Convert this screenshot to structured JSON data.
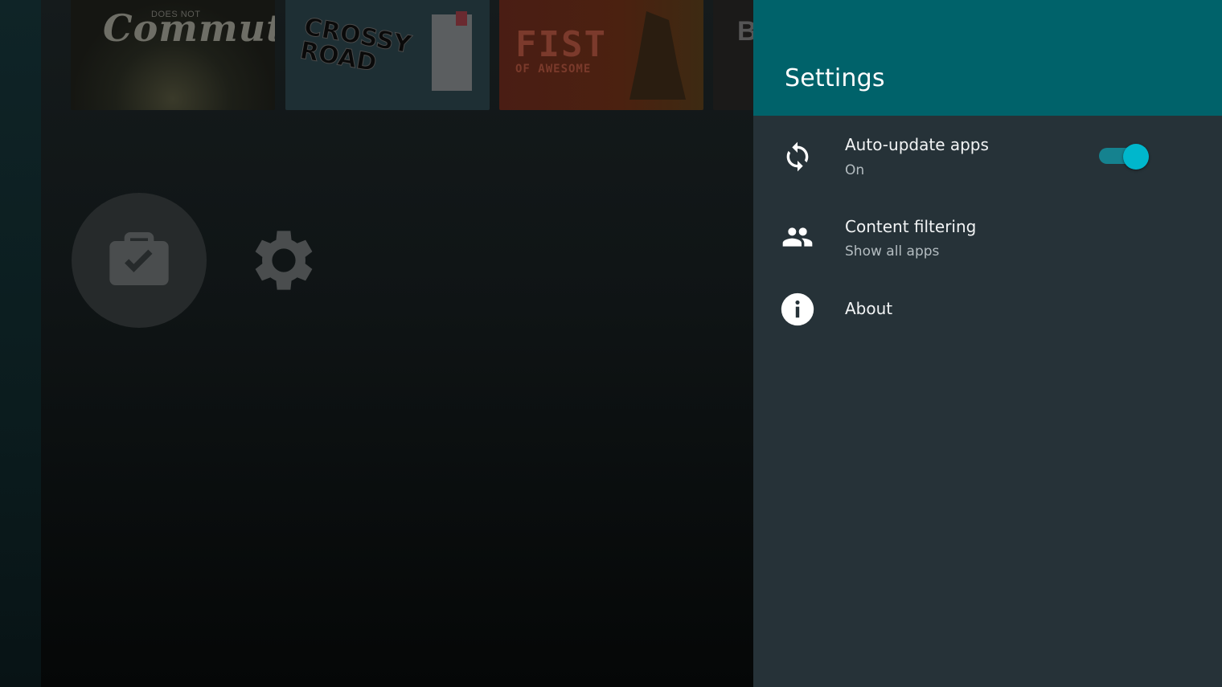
{
  "home": {
    "apps": [
      {
        "name": "Does Not Commute",
        "tag": "DOES NOT",
        "script_title": "Commute"
      },
      {
        "name": "Crossy Road",
        "line1": "CROSSY",
        "line2": "ROAD"
      },
      {
        "name": "Fist of Awesome",
        "title": "FIST",
        "subtitle": "OF AWESOME"
      },
      {
        "name": "partial-app",
        "letter": "B"
      }
    ],
    "shortcuts": [
      {
        "name": "Apps",
        "icon": "briefcase-check-icon"
      },
      {
        "name": "Settings",
        "icon": "gear-icon"
      }
    ]
  },
  "settings": {
    "title": "Settings",
    "items": [
      {
        "icon": "sync-icon",
        "title": "Auto-update apps",
        "subtitle": "On",
        "toggle": {
          "state": "on"
        }
      },
      {
        "icon": "people-icon",
        "title": "Content filtering",
        "subtitle": "Show all apps"
      },
      {
        "icon": "info-icon",
        "title": "About"
      }
    ]
  },
  "colors": {
    "header_bg": "#00626a",
    "panel_bg": "#263238",
    "toggle_thumb": "#00b7cc",
    "toggle_track": "#15828f"
  }
}
